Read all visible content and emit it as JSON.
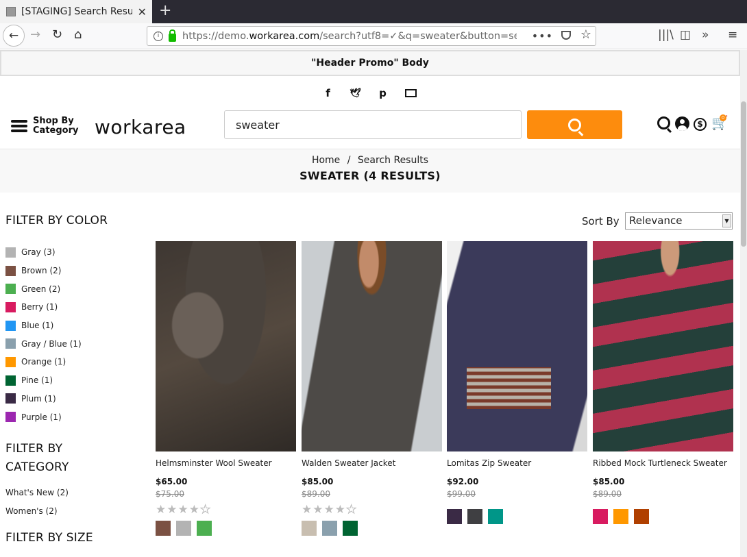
{
  "browser": {
    "tab_title": "[STAGING] Search Results",
    "url_prefix": "https://demo.",
    "url_domain": "workarea.com",
    "url_path": "/search?utf8=✓&q=sweater&button=search",
    "more_label": "•••"
  },
  "promo": {
    "text": "\"Header Promo\" Body"
  },
  "social": {
    "facebook": "f",
    "twitter": "🐦",
    "pinterest": "p"
  },
  "header": {
    "shop_by": "Shop By Category",
    "logo": "workarea",
    "search_value": "sweater",
    "orders_glyph": "$",
    "cart_glyph": "🛒",
    "cart_count": "0"
  },
  "breadcrumb": {
    "home": "Home",
    "sep": "/",
    "current": "Search Results"
  },
  "page_title": "SWEATER (4 RESULTS)",
  "filters": {
    "color_heading": "FILTER BY COLOR",
    "colors": [
      {
        "label": "Gray (3)",
        "color": "#b3b3b3"
      },
      {
        "label": "Brown (2)",
        "color": "#7b5143"
      },
      {
        "label": "Green (2)",
        "color": "#4caf50"
      },
      {
        "label": "Berry (1)",
        "color": "#d81b60"
      },
      {
        "label": "Blue (1)",
        "color": "#2196f3"
      },
      {
        "label": "Gray / Blue (1)",
        "color": "#8aa0ad"
      },
      {
        "label": "Orange (1)",
        "color": "#ff9800"
      },
      {
        "label": "Pine (1)",
        "color": "#006432"
      },
      {
        "label": "Plum (1)",
        "color": "#3a2a45"
      },
      {
        "label": "Purple (1)",
        "color": "#9c27b0"
      }
    ],
    "category_heading": "FILTER BY CATEGORY",
    "categories": [
      "What's New (2)",
      "Women's (2)"
    ],
    "size_heading": "FILTER BY SIZE"
  },
  "sort": {
    "label": "Sort By",
    "selected": "Relevance"
  },
  "products": [
    {
      "name": "Helmsminster Wool Sweater",
      "price": "$65.00",
      "old_price": "$75.00",
      "rating": 4,
      "swatches": [
        "#7b5143",
        "#b3b3b3",
        "#4caf50"
      ]
    },
    {
      "name": "Walden Sweater Jacket",
      "price": "$85.00",
      "old_price": "$89.00",
      "rating": 4,
      "swatches": [
        "#c8beb0",
        "#8aa0ad",
        "#006432"
      ]
    },
    {
      "name": "Lomitas Zip Sweater",
      "price": "$92.00",
      "old_price": "$99.00",
      "rating": 0,
      "swatches": [
        "#3a2a45",
        "#3f3f42",
        "#009688"
      ]
    },
    {
      "name": "Ribbed Mock Turtleneck Sweater",
      "price": "$85.00",
      "old_price": "$89.00",
      "rating": 0,
      "swatches": [
        "#d81b60",
        "#ff9800",
        "#b04000"
      ]
    }
  ]
}
